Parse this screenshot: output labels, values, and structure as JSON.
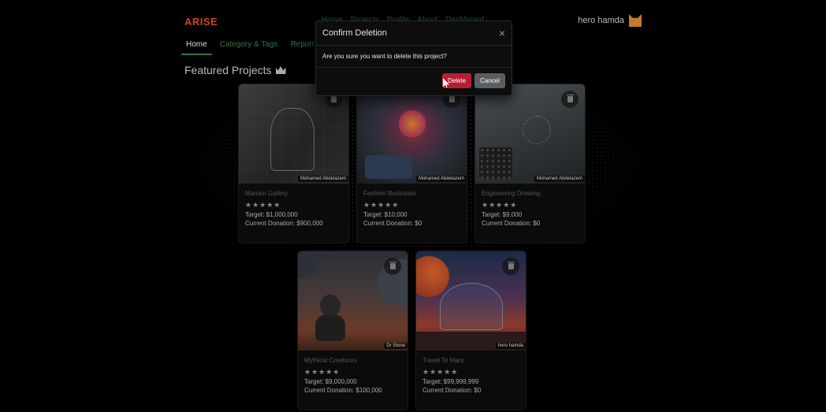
{
  "app": {
    "logo": "ARISE"
  },
  "topnav": {
    "items": [
      "Home",
      "Projects",
      "Profile",
      "About",
      "Dashboard"
    ]
  },
  "user": {
    "name": "hero hamda"
  },
  "tabs": [
    {
      "label": "Home",
      "active": true
    },
    {
      "label": "Category & Tags",
      "active": false
    },
    {
      "label": "Report",
      "active": false
    }
  ],
  "section": {
    "title": "Featured Projects"
  },
  "cards": [
    {
      "title": "Mariam Gallery",
      "rating": "★★★★★",
      "target": "Target: $1,000,000",
      "donation": "Current Donation: $900,000",
      "credit": "Mohamed Abdelazem"
    },
    {
      "title": "Fashion Illustration",
      "rating": "★★★★★",
      "target": "Target: $10,000",
      "donation": "Current Donation: $0",
      "credit": "Mohamed Abdelazem"
    },
    {
      "title": "Engineering Drawing",
      "rating": "★★★★★",
      "target": "Target: $9,000",
      "donation": "Current Donation: $0",
      "credit": "Mohamed Abdelazem"
    },
    {
      "title": "Mythical Creatures",
      "rating": "★★★★★",
      "target": "Target: $9,000,000",
      "donation": "Current Donation: $100,000",
      "credit": "Dr Stone"
    },
    {
      "title": "Travel To Mars",
      "rating": "★★★★★",
      "target": "Target: $99,999,999",
      "donation": "Current Donation: $0",
      "credit": "hero hamda"
    }
  ],
  "modal": {
    "title": "Confirm Deletion",
    "close": "×",
    "message": "Are you sure you want to delete this project?",
    "delete_label": "Delete",
    "cancel_label": "Cancel"
  },
  "colors": {
    "brand": "#d1431f",
    "accent_green": "#2d7a4a",
    "danger": "#b51f30",
    "secondary": "#5a5f63"
  }
}
